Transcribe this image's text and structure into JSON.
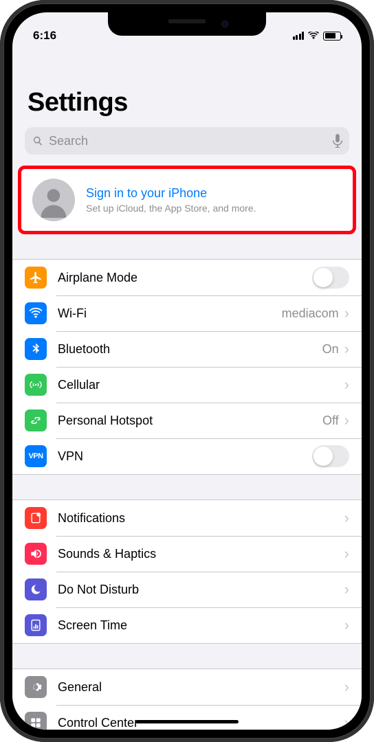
{
  "status": {
    "time": "6:16"
  },
  "page": {
    "title": "Settings"
  },
  "search": {
    "placeholder": "Search"
  },
  "signin": {
    "title": "Sign in to your iPhone",
    "subtitle": "Set up iCloud, the App Store, and more."
  },
  "group1": {
    "airplane": "Airplane Mode",
    "wifi": "Wi-Fi",
    "wifi_value": "mediacom",
    "bluetooth": "Bluetooth",
    "bluetooth_value": "On",
    "cellular": "Cellular",
    "hotspot": "Personal Hotspot",
    "hotspot_value": "Off",
    "vpn": "VPN"
  },
  "group2": {
    "notifications": "Notifications",
    "sounds": "Sounds & Haptics",
    "dnd": "Do Not Disturb",
    "screentime": "Screen Time"
  },
  "group3": {
    "general": "General",
    "controlcenter": "Control Center"
  }
}
